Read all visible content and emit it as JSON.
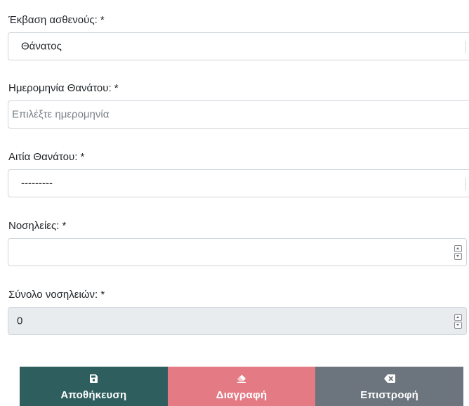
{
  "fields": {
    "outcome": {
      "label": "Έκβαση ασθενούς: *",
      "value": "Θάνατος"
    },
    "death_date": {
      "label": "Ημερομηνία Θανάτου: *",
      "placeholder": "Επιλέξτε ημερομηνία"
    },
    "death_cause": {
      "label": "Αιτία Θανάτου: *",
      "value": "---------"
    },
    "hospitalizations": {
      "label": "Νοσηλείες: *",
      "value": ""
    },
    "total_hospitalizations": {
      "label": "Σύνολο νοσηλειών: *",
      "value": "0"
    }
  },
  "buttons": {
    "save": {
      "label": "Αποθήκευση",
      "icon": "save-icon",
      "color": "#2f5e5e"
    },
    "delete": {
      "label": "Διαγραφή",
      "icon": "eraser-icon",
      "color": "#e47a84"
    },
    "back": {
      "label": "Επιστροφή",
      "icon": "backspace-icon",
      "color": "#6c757d"
    }
  }
}
